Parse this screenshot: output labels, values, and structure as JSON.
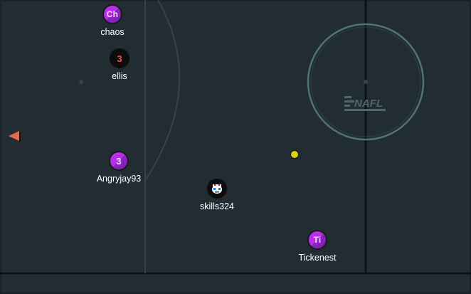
{
  "field": {
    "background_color": "#222c33",
    "line_color": "#000000",
    "arc_color": "#3b4d56",
    "circle_color": "#6e9aa0"
  },
  "center_logo": {
    "text": "NAFL",
    "icon": "nafl-logo-icon"
  },
  "ball": {
    "color": "#d8d40f",
    "icon": "ball-icon"
  },
  "direction_indicator": {
    "color": "#e26a4f",
    "icon": "left-arrow-icon"
  },
  "players": [
    {
      "name": "chaos",
      "badge": "Ch",
      "style": "purple"
    },
    {
      "name": "ellis",
      "badge": "3",
      "style": "black"
    },
    {
      "name": "Angryjay93",
      "badge": "3",
      "style": "purple"
    },
    {
      "name": "skills324",
      "badge": "",
      "style": "black",
      "icon": "face-icon"
    },
    {
      "name": "Tickenest",
      "badge": "Ti",
      "style": "purple"
    }
  ]
}
